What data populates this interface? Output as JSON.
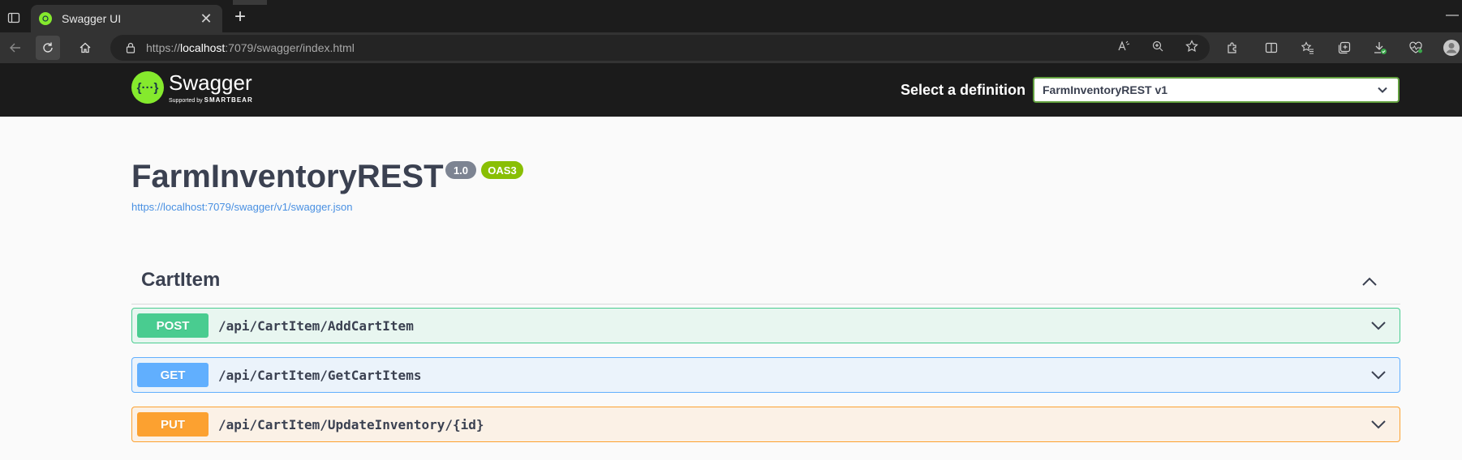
{
  "browser": {
    "tab_title": "Swagger UI",
    "tab_close": "✕",
    "new_tab": "+",
    "url_scheme": "https://",
    "url_host": "localhost",
    "url_rest": ":7079/swagger/index.html"
  },
  "swagger": {
    "logo_word": "Swagger",
    "logo_glyph": "{···}",
    "logo_supported": "Supported by",
    "logo_brand": "SMARTBEAR",
    "definition_label": "Select a definition",
    "definition_value": "FarmInventoryREST v1"
  },
  "info": {
    "title": "FarmInventoryREST",
    "version": "1.0",
    "oas": "OAS3",
    "spec_url": "https://localhost:7079/swagger/v1/swagger.json"
  },
  "tags": [
    {
      "name": "CartItem",
      "operations": [
        {
          "method": "POST",
          "path": "/api/CartItem/AddCartItem"
        },
        {
          "method": "GET",
          "path": "/api/CartItem/GetCartItems"
        },
        {
          "method": "PUT",
          "path": "/api/CartItem/UpdateInventory/{id}"
        }
      ]
    }
  ],
  "colors": {
    "post": "#49cc90",
    "get": "#61affe",
    "put": "#fca130",
    "swagger_green": "#85ea2d",
    "topbar": "#1b1b1b"
  }
}
